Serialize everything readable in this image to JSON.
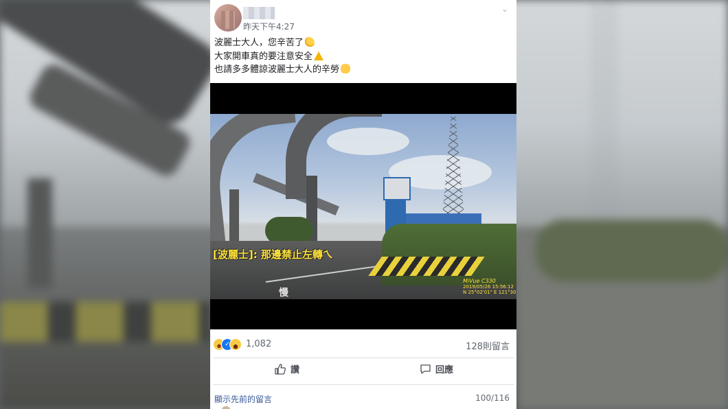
{
  "post": {
    "timestamp": "昨天下午4:27",
    "lines": [
      "波麗士大人，您辛苦了",
      "大家開車真的要注意安全",
      "也請多多體諒波麗士大人的辛勞"
    ],
    "emojis": [
      "flexed-biceps",
      "warning",
      "pointing-hand"
    ]
  },
  "video": {
    "caption": "[波麗士]: 那邊禁止左轉ㄟ",
    "camera_brand": "MiVue C330",
    "camera_meta": "2019/05/26 15:56:12",
    "camera_gps": "N 25°02'01\" E 121°30'51\"",
    "road_marking": "慢"
  },
  "stats": {
    "reaction_count": "1,082",
    "reactions": [
      "haha",
      "like",
      "wow"
    ],
    "comment_count": "128則留言"
  },
  "actions": {
    "like_label": "讚",
    "comment_label": "回應"
  },
  "comments": {
    "show_previous": "顯示先前的留言",
    "pager": "100/116"
  }
}
